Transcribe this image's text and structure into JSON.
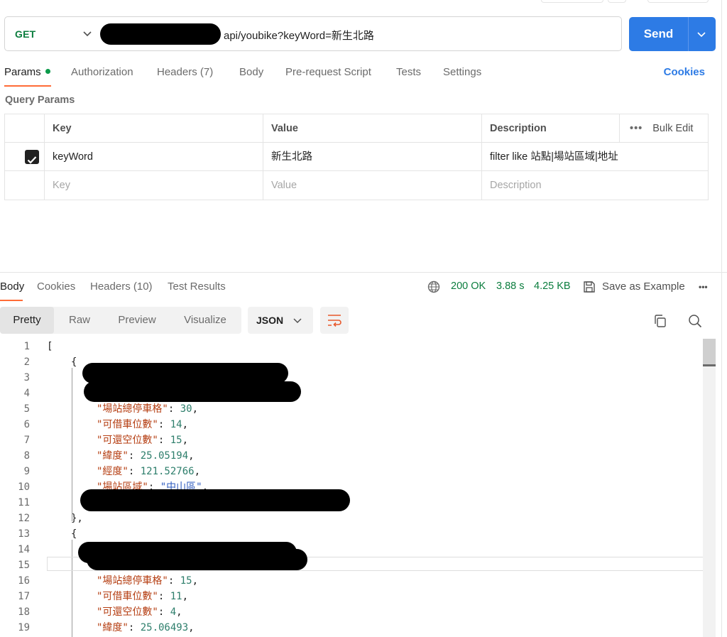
{
  "request": {
    "method": "GET",
    "url_visible": "api/youbike?keyWord=新生北路",
    "send_label": "Send"
  },
  "request_tabs": {
    "params": "Params",
    "authorization": "Authorization",
    "headers": "Headers (7)",
    "body": "Body",
    "prerequest": "Pre-request Script",
    "tests": "Tests",
    "settings": "Settings",
    "cookies": "Cookies"
  },
  "query_params": {
    "title": "Query Params",
    "headers": {
      "key": "Key",
      "value": "Value",
      "description": "Description",
      "bulk_edit": "Bulk Edit",
      "more": "•••"
    },
    "rows": [
      {
        "checked": true,
        "key": "keyWord",
        "value": "新生北路",
        "description": "filter like 站點|場站區域|地址"
      }
    ],
    "placeholders": {
      "key": "Key",
      "value": "Value",
      "description": "Description"
    }
  },
  "response_tabs": {
    "body": "Body",
    "cookies": "Cookies",
    "headers": "Headers (10)",
    "test_results": "Test Results"
  },
  "response_meta": {
    "status": "200 OK",
    "time": "3.88 s",
    "size": "4.25 KB",
    "save_example": "Save as Example",
    "more": "•••"
  },
  "response_toolbar": {
    "pretty": "Pretty",
    "raw": "Raw",
    "preview": "Preview",
    "visualize": "Visualize",
    "format": "JSON"
  },
  "code": {
    "line_numbers": [
      "1",
      "2",
      "3",
      "4",
      "5",
      "6",
      "7",
      "8",
      "9",
      "10",
      "11",
      "12",
      "13",
      "14",
      "15",
      "16",
      "17",
      "18",
      "19"
    ],
    "l1": "[",
    "l2": "{",
    "l5_key": "\"場站總停車格\"",
    "l5_val": "30",
    "l6_key": "\"可借車位數\"",
    "l6_val": "14",
    "l7_key": "\"可還空位數\"",
    "l7_val": "15",
    "l8_key": "\"緯度\"",
    "l8_val": "25.05194",
    "l9_key": "\"經度\"",
    "l9_val": "121.52766",
    "l10_key": "\"場站區域\"",
    "l10_val": "\"中山區\"",
    "l12": "},",
    "l13": "{",
    "l16_key": "\"場站總停車格\"",
    "l16_val": "15",
    "l17_key": "\"可借車位數\"",
    "l17_val": "11",
    "l18_key": "\"可還空位數\"",
    "l18_val": "4",
    "l19_key": "\"緯度\"",
    "l19_val": "25.06493"
  },
  "icons": {
    "method_dropdown": "chevron-down-icon",
    "send_dropdown": "chevron-down-icon",
    "checkbox": "checkmark-icon",
    "globe": "globe-icon",
    "save": "save-icon",
    "wrap": "wrap-lines-icon",
    "copy": "copy-icon",
    "search": "search-icon"
  },
  "colors": {
    "send_button": "#2d7be5",
    "tab_underline": "#ff6c37",
    "status_ok": "#0b7d3e",
    "json_key": "#b53e12",
    "json_number": "#2d7e6b",
    "json_string": "#2f5cc0"
  }
}
